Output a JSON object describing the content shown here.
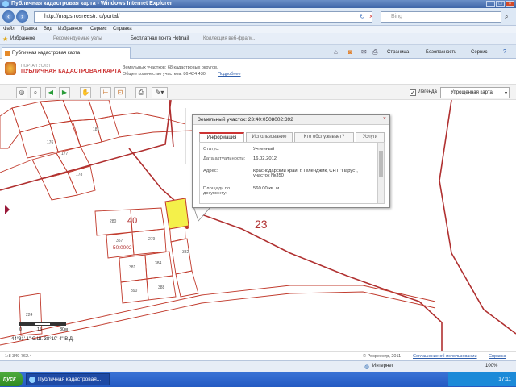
{
  "window": {
    "title": "Публичная кадастровая карта - Windows Internet Explorer"
  },
  "address": {
    "url": "http://maps.rosreestr.ru/portal/",
    "search_placeholder": "Bing"
  },
  "menu": [
    "Файл",
    "Правка",
    "Вид",
    "Избранное",
    "Сервис",
    "Справка"
  ],
  "favorites": {
    "label": "Избранное",
    "items": [
      "Рекомендуемые узлы",
      "Бесплатная почта Hotmail",
      "Коллекция веб-фрагм..."
    ]
  },
  "tab": {
    "label": "Публичная кадастровая карта"
  },
  "tools": [
    "Страница",
    "Безопасность",
    "Сервис"
  ],
  "header": {
    "portal_label": "ПОРТАЛ УСЛУГ",
    "title": "ПУБЛИЧНАЯ КАДАСТРОВАЯ КАРТА",
    "info_line1": "Земельных участков: 68 кадастровых округов.",
    "info_line2": "Общее количество участков: 86 424 430.",
    "info_link": "Подробнее"
  },
  "map_toolbar": {
    "legend_label": "Легенда",
    "legend_checked": true,
    "map_select": "Упрощенная карта"
  },
  "map": {
    "labels": [
      "40",
      "23",
      "50:0002"
    ],
    "parcels": [
      "181",
      "176",
      "177",
      "178",
      "280",
      "357",
      "279",
      "381",
      "384",
      "382",
      "390",
      "388",
      "224"
    ],
    "scale": {
      "ticks": [
        "0",
        "15",
        "30м"
      ]
    },
    "coords": "44°31' 1\" С.Ш.  38°10' 4\" В.Д."
  },
  "popup": {
    "title": "Земельный участок: 23:40:0508002:392",
    "tabs": [
      "Информация",
      "Использование",
      "Кто обслуживает?",
      "Услуги"
    ],
    "active_tab": 0,
    "rows": [
      {
        "key": "Статус:",
        "value": "Учтенный"
      },
      {
        "key": "Дата актуальности:",
        "value": "16.02.2012"
      },
      {
        "key": "Адрес:",
        "value": "Краснодарский край, г. Геленджик, СНТ \"Парус\", участок №350"
      },
      {
        "key": "Площадь по документу:",
        "value": "560.00 кв. м"
      }
    ]
  },
  "footer": {
    "scale_text": "1:8 349 762.4",
    "copyright": "© Росреестр, 2011",
    "link1": "Соглашение об использовании",
    "link2": "Справка"
  },
  "status": {
    "zone": "Интернет",
    "zoom": "100%"
  },
  "taskbar": {
    "start": "пуск",
    "task": "Публичная кадастровая...",
    "lang": "RU",
    "time": "17:11"
  },
  "colors": {
    "parcel_line": "#c0392b",
    "boundary_line": "#b03030",
    "selected_parcel": "#f4f04a",
    "title_gradient_top": "#6b8fc7",
    "taskbar": "#245ac2"
  }
}
